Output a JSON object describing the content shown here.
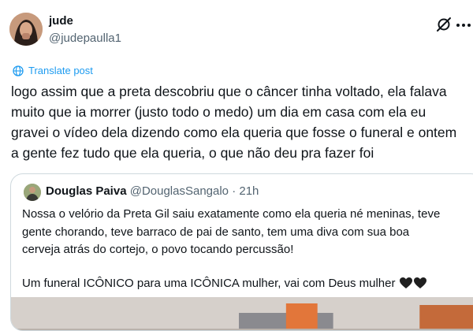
{
  "tweet": {
    "display_name": "jude",
    "handle": "@judepaulla1",
    "translate_label": "Translate post",
    "text_lines": [
      "logo assim que a preta descobriu que o câncer tinha voltado, ela falava",
      "muito que ia morrer (justo todo o medo) um dia em casa com ela eu",
      "gravei o vídeo dela dizendo como ela queria que fosse o funeral e ontem",
      "a gente fez tudo que ela queria, o que não deu pra fazer foi"
    ]
  },
  "quote": {
    "display_name": "Douglas Paiva",
    "handle": "@DouglasSangalo",
    "separator": "·",
    "time": "21h",
    "text_lines": [
      "Nossa o velório da Preta Gil saiu exatamente como ela queria né meninas, teve",
      "gente chorando, teve barraco de pai de santo, tem uma diva com sua boa",
      "cerveja atrás do cortejo, o povo tocando percussão!"
    ],
    "text_line_last": "Um funeral ICÔNICO para uma ICÔNICA mulher, vai com Deus mulher"
  },
  "icons": {
    "grok": "grok-icon",
    "more": "more-icon",
    "translate": "globe-icon",
    "hearts": "black-heart-icon"
  },
  "colors": {
    "link": "#1d9bf0",
    "secondary_text": "#536471",
    "border": "#cfd9de"
  }
}
